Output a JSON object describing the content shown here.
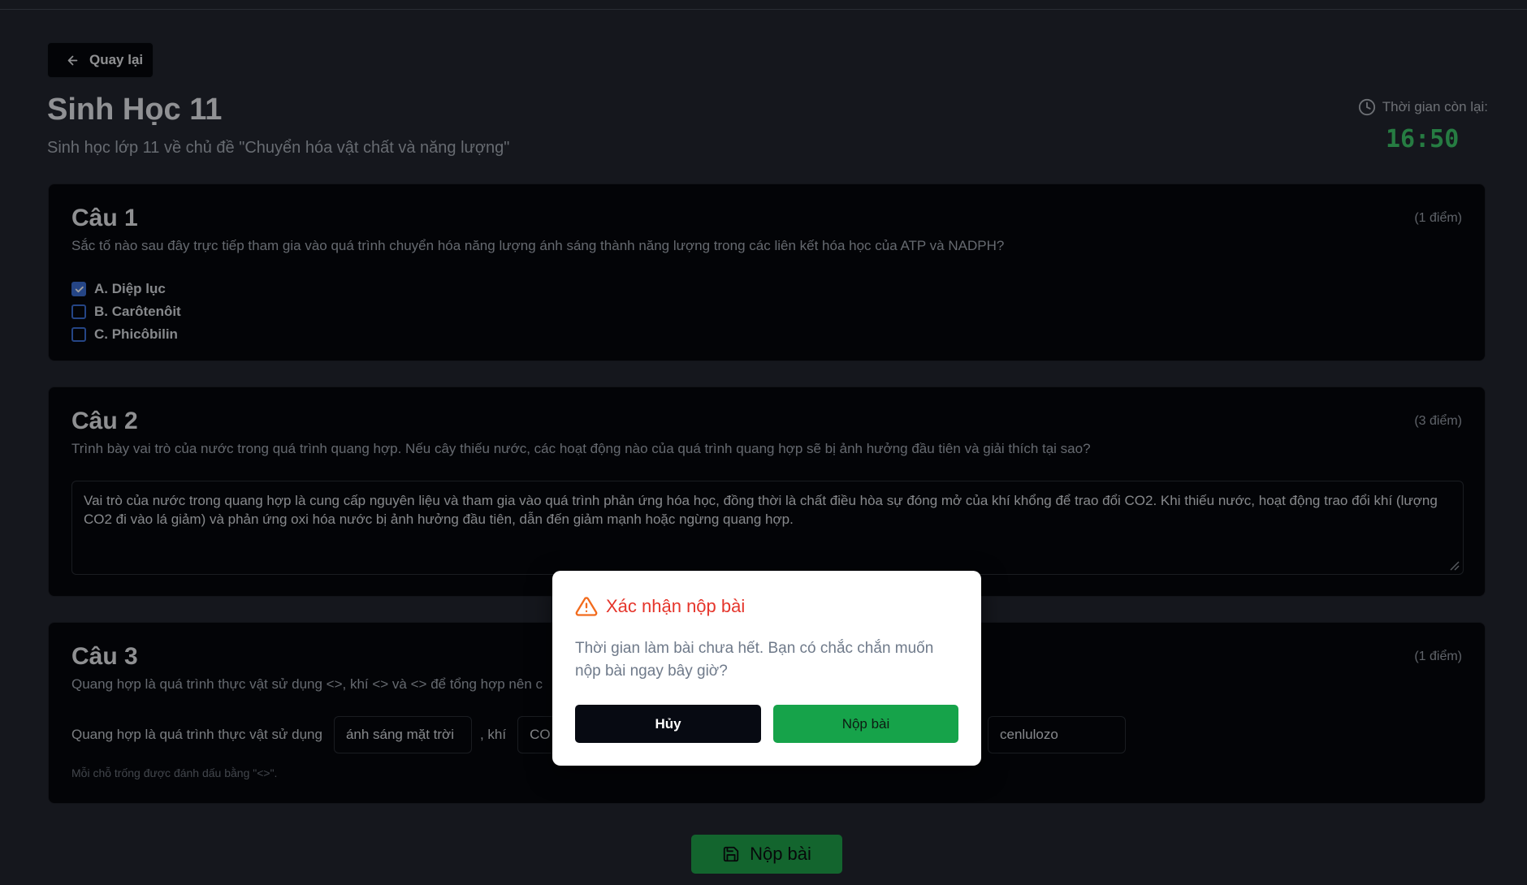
{
  "header": {
    "back_label": "Quay lại",
    "title": "Sinh Học 11",
    "subtitle": "Sinh học lớp 11 về chủ đề \"Chuyển hóa vật chất và năng lượng\"",
    "timer_label": "Thời gian còn lại:",
    "timer_value": "16:50"
  },
  "questions": [
    {
      "title": "Câu 1",
      "points": "(1 điểm)",
      "text": "Sắc tố nào sau đây trực tiếp tham gia vào quá trình chuyển hóa năng lượng ánh sáng thành năng lượng trong các liên kết hóa học của ATP và NADPH?",
      "options": [
        {
          "label": "A. Diệp lục",
          "checked": true
        },
        {
          "label": "B. Carôtenôit",
          "checked": false
        },
        {
          "label": "C. Phicôbilin",
          "checked": false
        }
      ]
    },
    {
      "title": "Câu 2",
      "points": "(3 điểm)",
      "text": "Trình bày vai trò của nước trong quá trình quang hợp. Nếu cây thiếu nước, các hoạt động nào của quá trình quang hợp sẽ bị ảnh hưởng đầu tiên và giải thích tại sao?",
      "answer": "Vai trò của nước trong quang hợp là cung cấp nguyên liệu và tham gia vào quá trình phản ứng hóa học, đồng thời là chất điều hòa sự đóng mở của khí khổng để trao đổi CO2. Khi thiếu nước, hoạt động trao đổi khí (lượng CO2 đi vào lá giảm) và phản ứng oxi hóa nước bị ảnh hưởng đầu tiên, dẫn đến giảm mạnh hoặc ngừng quang hợp."
    },
    {
      "title": "Câu 3",
      "points": "(1 điểm)",
      "text": "Quang hợp là quá trình thực vật sử dụng <>, khí <> và <> để tổng hợp nên c",
      "fill_prefix": "Quang hợp là quá trình thực vật sử dụng",
      "blank_1": "ánh sáng mặt trời",
      "sep_1": ", khí",
      "blank_2": "CO",
      "blank_4": "cenlulozo",
      "hint": "Mỗi chỗ trống được đánh dấu bằng \"<>\"."
    }
  ],
  "submit_label": "Nộp bài",
  "modal": {
    "title": "Xác nhận nộp bài",
    "body": "Thời gian làm bài chưa hết. Bạn có chắc chắn muốn nộp bài ngay bây giờ?",
    "cancel_label": "Hủy",
    "confirm_label": "Nộp bài"
  },
  "colors": {
    "accent_green": "#16a34a",
    "timer_green": "#3ec86a",
    "warning_red": "#e5352b",
    "checkbox_blue": "#3b6fd6"
  }
}
